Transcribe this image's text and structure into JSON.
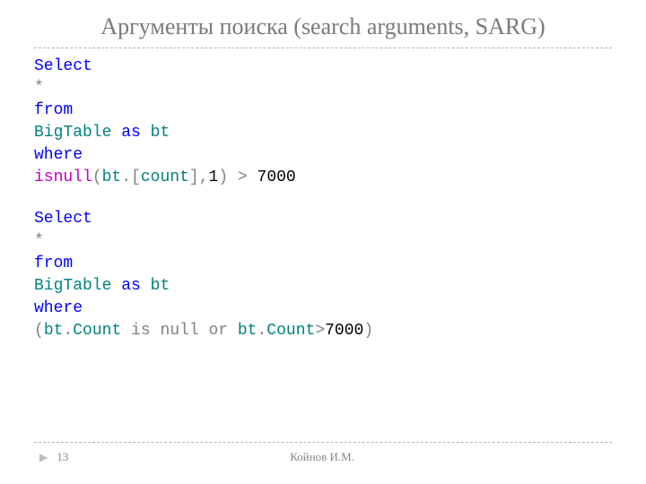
{
  "title": "Аргументы поиска (search arguments, SARG)",
  "code1": {
    "select": "Select",
    "star": "*",
    "from": "from",
    "table": "BigTable",
    "as": "as",
    "alias": "bt",
    "where": "where",
    "func": "isnull",
    "p_open": "(",
    "bt": "bt",
    "dot": ".",
    "br_open": "[",
    "col": "count",
    "br_close": "]",
    "comma": ",",
    "default": "1",
    "p_close": ")",
    "gt": " > ",
    "val": "7000"
  },
  "code2": {
    "select": "Select",
    "star": "*",
    "from": "from",
    "table": "BigTable",
    "as": "as",
    "alias": "bt",
    "where": "where",
    "p_open": "(",
    "bt1": "bt",
    "dot1": ".",
    "col1": "Count",
    "isnull": " is null or ",
    "bt2": "bt",
    "dot2": ".",
    "col2": "Count",
    "gt": ">",
    "val": "7000",
    "p_close": ")"
  },
  "footer": {
    "page": "13",
    "author": "Койнов И.М."
  }
}
